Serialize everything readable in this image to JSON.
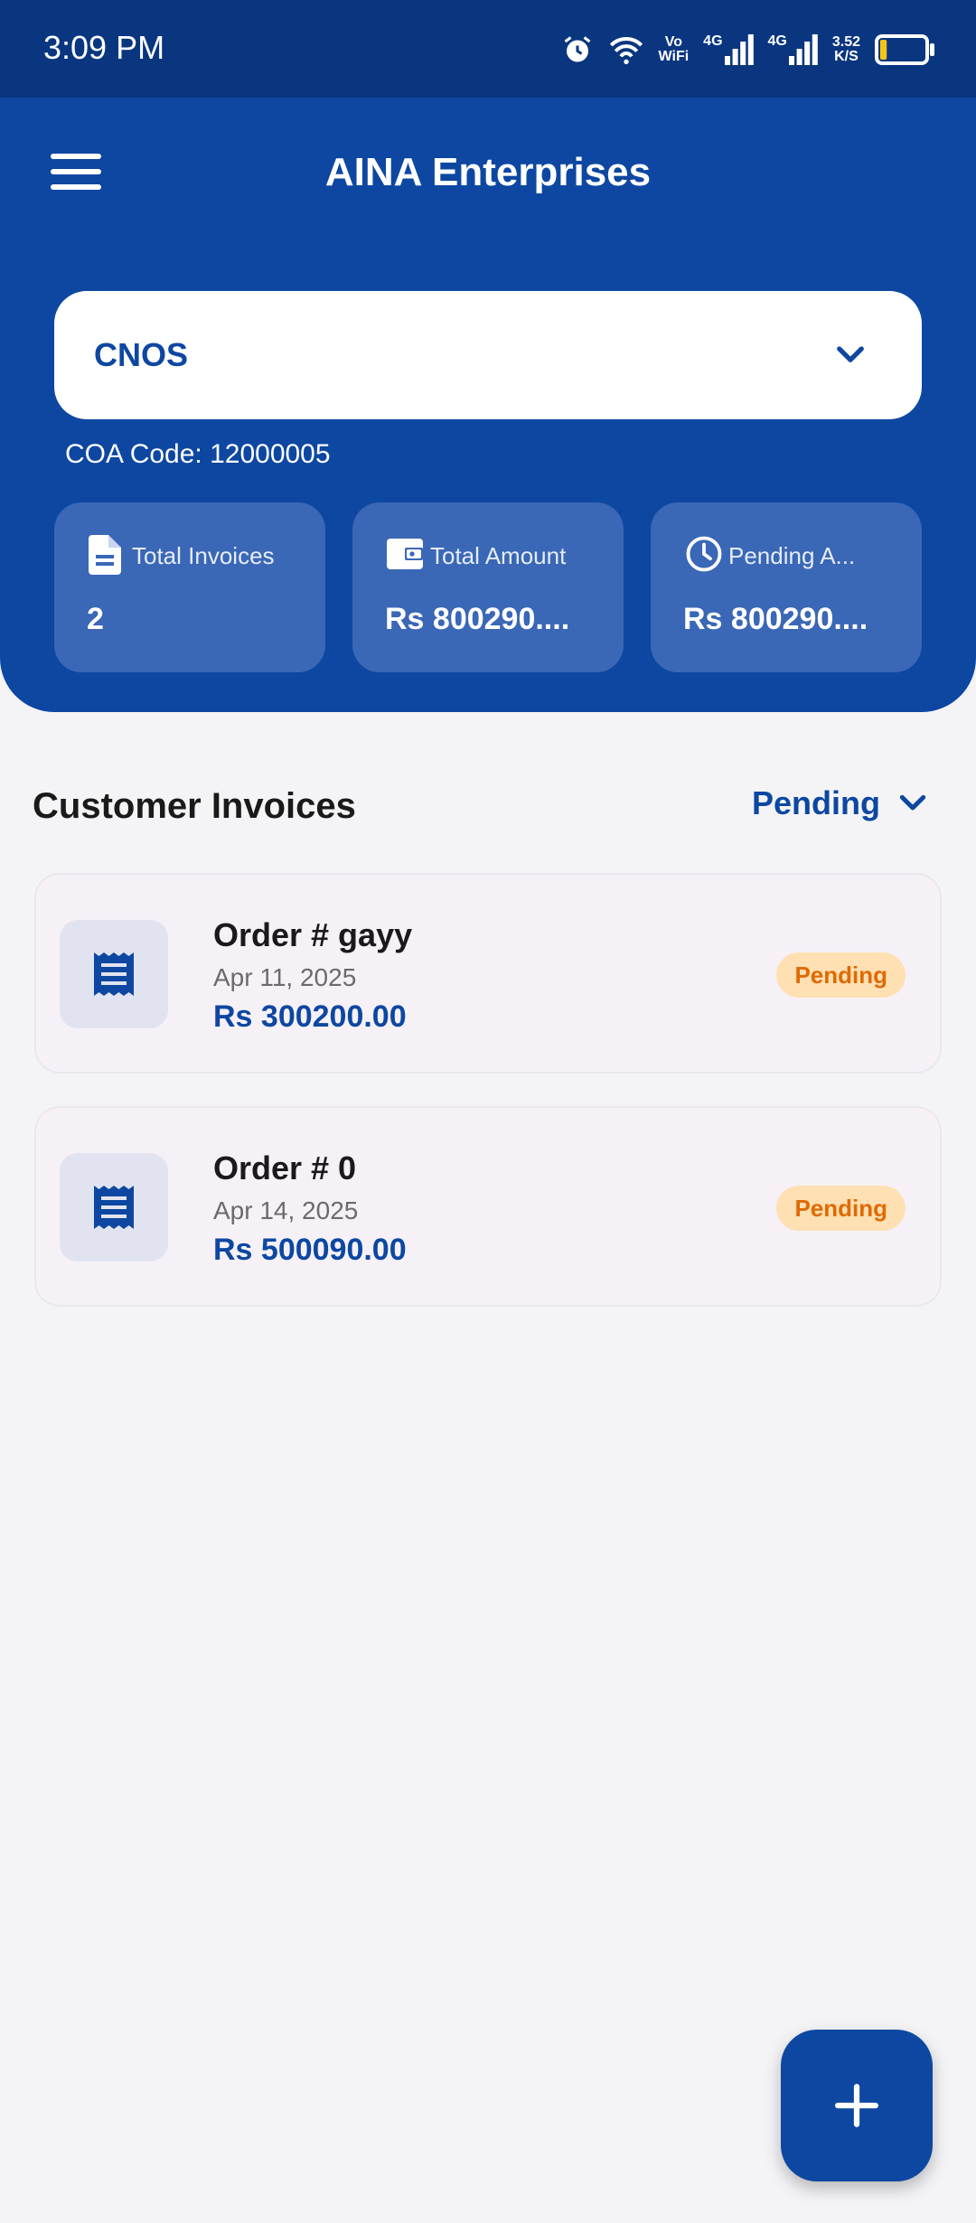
{
  "status_bar": {
    "time": "3:09 PM",
    "vo": "Vo",
    "wifi": "WiFi",
    "net1": "4G",
    "net2": "4G",
    "speed_value": "3.52",
    "speed_unit": "K/S",
    "battery_level": 0.15
  },
  "header": {
    "title": "AINA Enterprises",
    "customer_selected": "CNOS",
    "coa_code": "COA Code: 12000005"
  },
  "stats": [
    {
      "label": "Total Invoices",
      "value": "2",
      "icon": "document-icon"
    },
    {
      "label": "Total Amount",
      "value": "Rs 800290....",
      "icon": "wallet-icon"
    },
    {
      "label": "Pending A...",
      "value": "Rs 800290....",
      "icon": "clock-icon"
    }
  ],
  "section": {
    "title": "Customer Invoices",
    "filter": "Pending"
  },
  "invoices": [
    {
      "order": "Order # gayy",
      "date": "Apr 11, 2025",
      "amount": "Rs 300200.00",
      "status": "Pending"
    },
    {
      "order": "Order # 0",
      "date": "Apr 14, 2025",
      "amount": "Rs 500090.00",
      "status": "Pending"
    }
  ],
  "colors": {
    "primary": "#0d47a1",
    "status_bar": "#0a3680",
    "pending_badge_bg": "#ffe0b3",
    "pending_badge_text": "#e06a00"
  }
}
